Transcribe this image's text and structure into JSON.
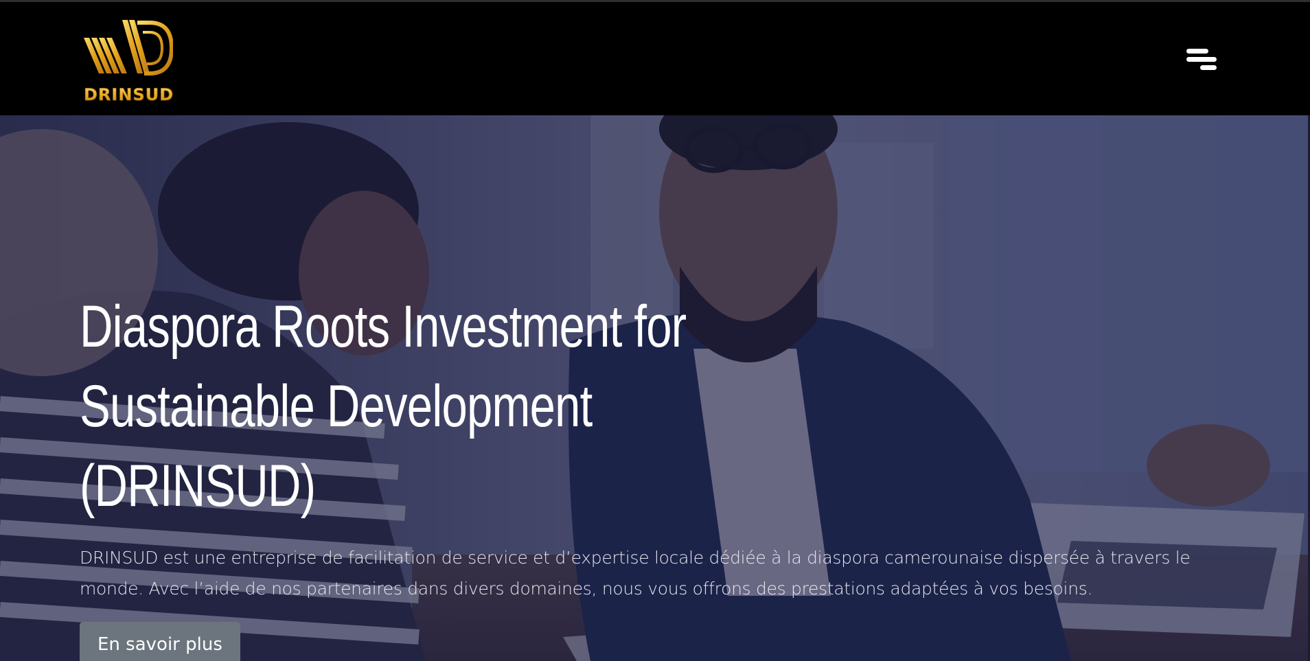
{
  "header": {
    "logo_text": "DRINSUD",
    "logo_icon": "drinsud-logo-icon",
    "menu_icon": "hamburger-menu-icon"
  },
  "hero": {
    "title_line1": "Diaspora Roots Investment for",
    "title_line2": "Sustainable Development (DRINSUD)",
    "description": "DRINSUD est une entreprise de facilitation de service et d’expertise locale dédiée à la diaspora camerounaise dispersée à travers le monde. Avec l’aide de nos partenaires dans divers domaines, nous vous offrons des prestations adaptées à vos besoins.",
    "cta_label": "En savoir plus"
  },
  "colors": {
    "header_bg": "#000000",
    "logo_gold": "#e7a51b",
    "overlay": "#1c1e46",
    "button_bg": "#6c757d"
  }
}
